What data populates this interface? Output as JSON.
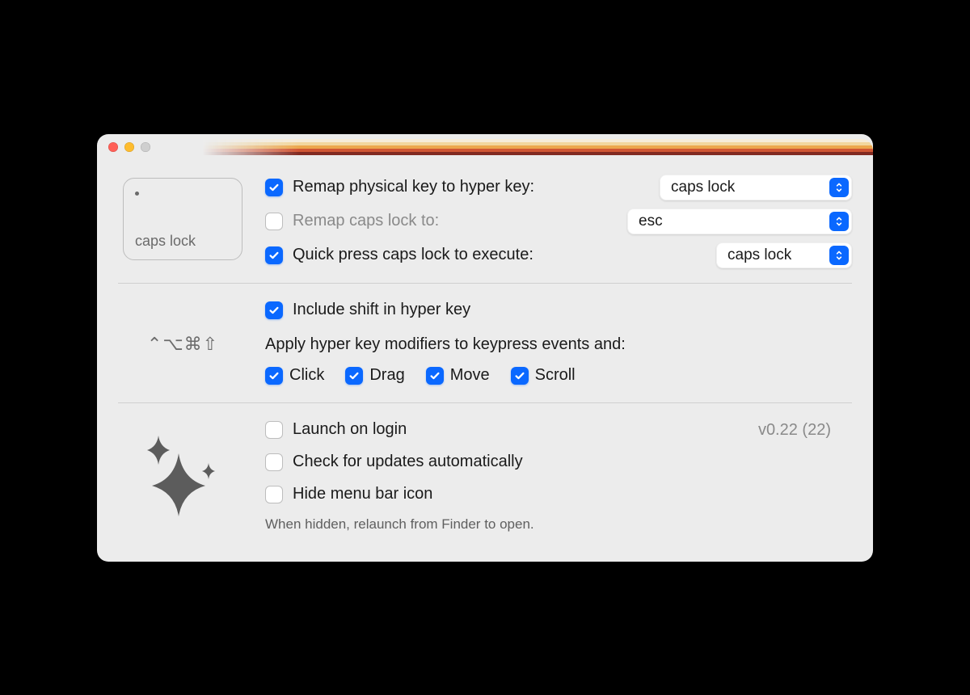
{
  "keycap": {
    "label": "caps lock"
  },
  "modifiers_glyphs": "⌃⌥⌘⇧",
  "section1": {
    "remap_hyper": {
      "checked": true,
      "label": "Remap physical key to hyper key:",
      "value": "caps lock"
    },
    "remap_capslock": {
      "checked": false,
      "disabled": true,
      "label": "Remap caps lock to:",
      "value": "esc"
    },
    "quick_press": {
      "checked": true,
      "label": "Quick press caps lock to execute:",
      "value": "caps lock"
    }
  },
  "section2": {
    "include_shift": {
      "checked": true,
      "label": "Include shift in hyper key"
    },
    "apply_heading": "Apply hyper key modifiers to keypress events and:",
    "events": [
      {
        "key": "click",
        "label": "Click",
        "checked": true
      },
      {
        "key": "drag",
        "label": "Drag",
        "checked": true
      },
      {
        "key": "move",
        "label": "Move",
        "checked": true
      },
      {
        "key": "scroll",
        "label": "Scroll",
        "checked": true
      }
    ]
  },
  "section3": {
    "version": "v0.22 (22)",
    "launch_login": {
      "checked": false,
      "label": "Launch on login"
    },
    "check_updates": {
      "checked": false,
      "label": "Check for updates automatically"
    },
    "hide_menubar": {
      "checked": false,
      "label": "Hide menu bar icon"
    },
    "hint": "When hidden, relaunch from Finder to open."
  }
}
